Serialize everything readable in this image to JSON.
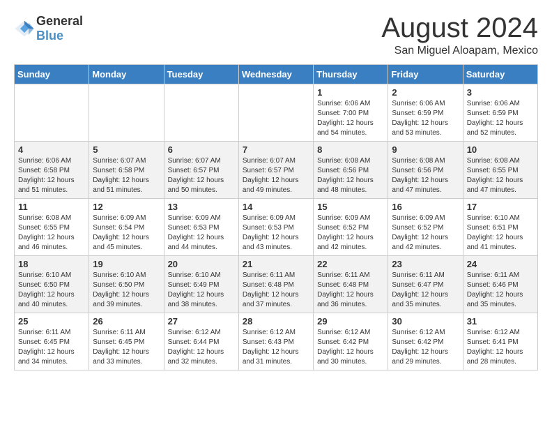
{
  "logo": {
    "general": "General",
    "blue": "Blue"
  },
  "title": {
    "month_year": "August 2024",
    "location": "San Miguel Aloapam, Mexico"
  },
  "headers": [
    "Sunday",
    "Monday",
    "Tuesday",
    "Wednesday",
    "Thursday",
    "Friday",
    "Saturday"
  ],
  "weeks": [
    [
      {
        "day": "",
        "content": ""
      },
      {
        "day": "",
        "content": ""
      },
      {
        "day": "",
        "content": ""
      },
      {
        "day": "",
        "content": ""
      },
      {
        "day": "1",
        "content": "Sunrise: 6:06 AM\nSunset: 7:00 PM\nDaylight: 12 hours\nand 54 minutes."
      },
      {
        "day": "2",
        "content": "Sunrise: 6:06 AM\nSunset: 6:59 PM\nDaylight: 12 hours\nand 53 minutes."
      },
      {
        "day": "3",
        "content": "Sunrise: 6:06 AM\nSunset: 6:59 PM\nDaylight: 12 hours\nand 52 minutes."
      }
    ],
    [
      {
        "day": "4",
        "content": "Sunrise: 6:06 AM\nSunset: 6:58 PM\nDaylight: 12 hours\nand 51 minutes."
      },
      {
        "day": "5",
        "content": "Sunrise: 6:07 AM\nSunset: 6:58 PM\nDaylight: 12 hours\nand 51 minutes."
      },
      {
        "day": "6",
        "content": "Sunrise: 6:07 AM\nSunset: 6:57 PM\nDaylight: 12 hours\nand 50 minutes."
      },
      {
        "day": "7",
        "content": "Sunrise: 6:07 AM\nSunset: 6:57 PM\nDaylight: 12 hours\nand 49 minutes."
      },
      {
        "day": "8",
        "content": "Sunrise: 6:08 AM\nSunset: 6:56 PM\nDaylight: 12 hours\nand 48 minutes."
      },
      {
        "day": "9",
        "content": "Sunrise: 6:08 AM\nSunset: 6:56 PM\nDaylight: 12 hours\nand 47 minutes."
      },
      {
        "day": "10",
        "content": "Sunrise: 6:08 AM\nSunset: 6:55 PM\nDaylight: 12 hours\nand 47 minutes."
      }
    ],
    [
      {
        "day": "11",
        "content": "Sunrise: 6:08 AM\nSunset: 6:55 PM\nDaylight: 12 hours\nand 46 minutes."
      },
      {
        "day": "12",
        "content": "Sunrise: 6:09 AM\nSunset: 6:54 PM\nDaylight: 12 hours\nand 45 minutes."
      },
      {
        "day": "13",
        "content": "Sunrise: 6:09 AM\nSunset: 6:53 PM\nDaylight: 12 hours\nand 44 minutes."
      },
      {
        "day": "14",
        "content": "Sunrise: 6:09 AM\nSunset: 6:53 PM\nDaylight: 12 hours\nand 43 minutes."
      },
      {
        "day": "15",
        "content": "Sunrise: 6:09 AM\nSunset: 6:52 PM\nDaylight: 12 hours\nand 42 minutes."
      },
      {
        "day": "16",
        "content": "Sunrise: 6:09 AM\nSunset: 6:52 PM\nDaylight: 12 hours\nand 42 minutes."
      },
      {
        "day": "17",
        "content": "Sunrise: 6:10 AM\nSunset: 6:51 PM\nDaylight: 12 hours\nand 41 minutes."
      }
    ],
    [
      {
        "day": "18",
        "content": "Sunrise: 6:10 AM\nSunset: 6:50 PM\nDaylight: 12 hours\nand 40 minutes."
      },
      {
        "day": "19",
        "content": "Sunrise: 6:10 AM\nSunset: 6:50 PM\nDaylight: 12 hours\nand 39 minutes."
      },
      {
        "day": "20",
        "content": "Sunrise: 6:10 AM\nSunset: 6:49 PM\nDaylight: 12 hours\nand 38 minutes."
      },
      {
        "day": "21",
        "content": "Sunrise: 6:11 AM\nSunset: 6:48 PM\nDaylight: 12 hours\nand 37 minutes."
      },
      {
        "day": "22",
        "content": "Sunrise: 6:11 AM\nSunset: 6:48 PM\nDaylight: 12 hours\nand 36 minutes."
      },
      {
        "day": "23",
        "content": "Sunrise: 6:11 AM\nSunset: 6:47 PM\nDaylight: 12 hours\nand 35 minutes."
      },
      {
        "day": "24",
        "content": "Sunrise: 6:11 AM\nSunset: 6:46 PM\nDaylight: 12 hours\nand 35 minutes."
      }
    ],
    [
      {
        "day": "25",
        "content": "Sunrise: 6:11 AM\nSunset: 6:45 PM\nDaylight: 12 hours\nand 34 minutes."
      },
      {
        "day": "26",
        "content": "Sunrise: 6:11 AM\nSunset: 6:45 PM\nDaylight: 12 hours\nand 33 minutes."
      },
      {
        "day": "27",
        "content": "Sunrise: 6:12 AM\nSunset: 6:44 PM\nDaylight: 12 hours\nand 32 minutes."
      },
      {
        "day": "28",
        "content": "Sunrise: 6:12 AM\nSunset: 6:43 PM\nDaylight: 12 hours\nand 31 minutes."
      },
      {
        "day": "29",
        "content": "Sunrise: 6:12 AM\nSunset: 6:42 PM\nDaylight: 12 hours\nand 30 minutes."
      },
      {
        "day": "30",
        "content": "Sunrise: 6:12 AM\nSunset: 6:42 PM\nDaylight: 12 hours\nand 29 minutes."
      },
      {
        "day": "31",
        "content": "Sunrise: 6:12 AM\nSunset: 6:41 PM\nDaylight: 12 hours\nand 28 minutes."
      }
    ]
  ]
}
